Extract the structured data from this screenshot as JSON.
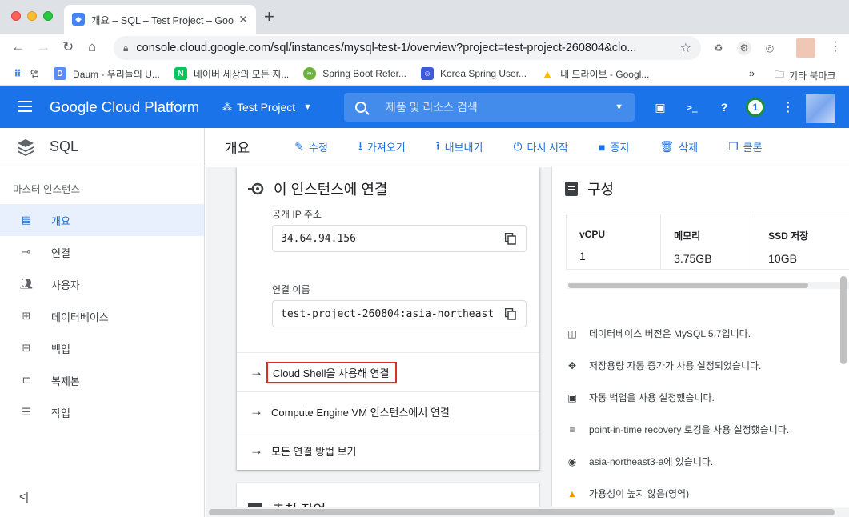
{
  "browser": {
    "tab_title": "개요 – SQL – Test Project – Goo",
    "url": "console.cloud.google.com/sql/instances/mysql-test-1/overview?project=test-project-260804&clo...",
    "bookmarks": [
      {
        "label": "앱",
        "icon": "apps-grid-icon"
      },
      {
        "label": "Daum - 우리들의 U...",
        "icon": "daum-icon"
      },
      {
        "label": "네이버 세상의 모든 지...",
        "icon": "naver-icon"
      },
      {
        "label": "Spring Boot Refer...",
        "icon": "spring-icon"
      },
      {
        "label": "Korea Spring User...",
        "icon": "ksug-icon"
      },
      {
        "label": "내 드라이브 - Googl...",
        "icon": "drive-icon"
      }
    ],
    "bookmarks_more": "»",
    "bookmarks_other": "기타 북마크"
  },
  "gcp": {
    "brand": "Google Cloud Platform",
    "project": "Test Project",
    "search_placeholder": "제품 및 리소스 검색",
    "notification_count": "1"
  },
  "sidebar": {
    "title": "SQL",
    "section": "마스터 인스턴스",
    "items": [
      {
        "label": "개요",
        "icon": "dashboard-icon",
        "active": true
      },
      {
        "label": "연결",
        "icon": "connection-icon"
      },
      {
        "label": "사용자",
        "icon": "users-icon"
      },
      {
        "label": "데이터베이스",
        "icon": "database-icon"
      },
      {
        "label": "백업",
        "icon": "backup-icon"
      },
      {
        "label": "복제본",
        "icon": "replica-icon"
      },
      {
        "label": "작업",
        "icon": "operations-icon"
      }
    ],
    "collapse": "<|"
  },
  "actions": {
    "page_title": "개요",
    "items": [
      {
        "label": "수정",
        "icon": "edit-icon"
      },
      {
        "label": "가져오기",
        "icon": "import-icon"
      },
      {
        "label": "내보내기",
        "icon": "export-icon"
      },
      {
        "label": "다시 시작",
        "icon": "restart-icon"
      },
      {
        "label": "중지",
        "icon": "stop-icon"
      },
      {
        "label": "삭제",
        "icon": "delete-icon"
      },
      {
        "label": "클론",
        "icon": "clone-icon"
      }
    ]
  },
  "connect": {
    "title": "이 인스턴스에 연결",
    "public_ip_label": "공개 IP 주소",
    "public_ip": "34.64.94.156",
    "conn_name_label": "연결 이름",
    "conn_name": "test-project-260804:asia-northeast",
    "links": [
      "Cloud Shell을 사용해 연결",
      "Compute Engine VM 인스턴스에서 연결",
      "모든 연결 방법 보기"
    ],
    "next_card_title": "추천 작업"
  },
  "config": {
    "title": "구성",
    "specs": [
      {
        "key": "vCPU",
        "value": "1"
      },
      {
        "key": "메모리",
        "value": "3.75GB"
      },
      {
        "key": "SSD 저장",
        "value": "10GB"
      }
    ],
    "info": [
      {
        "text": "데이터베이스 버전은 MySQL 5.7입니다.",
        "icon": "version-icon"
      },
      {
        "text": "저장용량 자동 증가가 사용 설정되었습니다.",
        "icon": "autoscale-icon"
      },
      {
        "text": "자동 백업을 사용 설정했습니다.",
        "icon": "backup-icon"
      },
      {
        "text": "point-in-time recovery 로깅을 사용 설정했습니다.",
        "icon": "log-icon"
      },
      {
        "text": "asia-northeast3-a에 있습니다.",
        "icon": "globe-icon"
      },
      {
        "text": "가용성이 높지 않음(영역)",
        "icon": "warning-icon"
      }
    ]
  },
  "colors": {
    "gcp_blue": "#1a73e8",
    "highlight_red": "#d93025",
    "active_bg": "#e8f0fe"
  }
}
